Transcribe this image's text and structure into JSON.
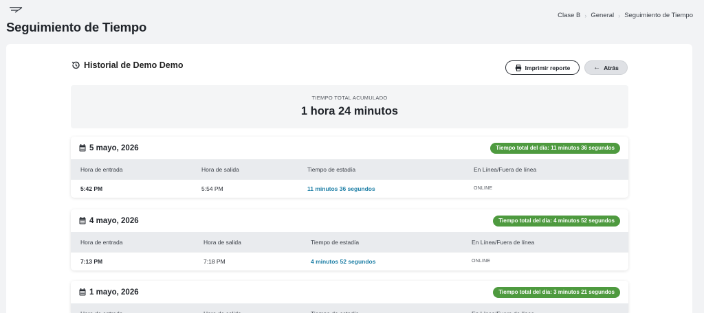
{
  "header": {
    "page_title": "Seguimiento de Tiempo",
    "breadcrumb": [
      "Clase B",
      "General",
      "Seguimiento de Tiempo"
    ]
  },
  "section": {
    "title": "Historial de Demo Demo",
    "print_label": "Imprimir reporte",
    "back_label": "Atrás"
  },
  "summary": {
    "label": "TIEMPO TOTAL ACUMULADO",
    "value": "1 hora 24 minutos"
  },
  "columns": [
    "Hora de entrada",
    "Hora de salida",
    "Tiempo de estadía",
    "En Línea/Fuera de línea"
  ],
  "days": [
    {
      "date": "5 mayo, 2026",
      "badge": "Tiempo total del día: 11 minutos 36 segundos",
      "rows": [
        {
          "entry": "5:42 PM",
          "exit": "5:54 PM",
          "stay": "11 minutos 36 segundos",
          "status": "ONLINE"
        }
      ]
    },
    {
      "date": "4 mayo, 2026",
      "badge": "Tiempo total del día: 4 minutos 52 segundos",
      "rows": [
        {
          "entry": "7:13 PM",
          "exit": "7:18 PM",
          "stay": "4 minutos 52 segundos",
          "status": "ONLINE"
        }
      ]
    },
    {
      "date": "1 mayo, 2026",
      "badge": "Tiempo total del día: 3 minutos 21 segundos",
      "rows": []
    }
  ],
  "colors": {
    "badge_green": "#4e9a3f",
    "stay_link": "#1e7fa6",
    "table_header_bg": "#e9ebee"
  },
  "icons": [
    "logo-icon",
    "history-icon",
    "printer-icon",
    "arrow-left-icon",
    "calendar-icon",
    "chevron-right-icon"
  ]
}
